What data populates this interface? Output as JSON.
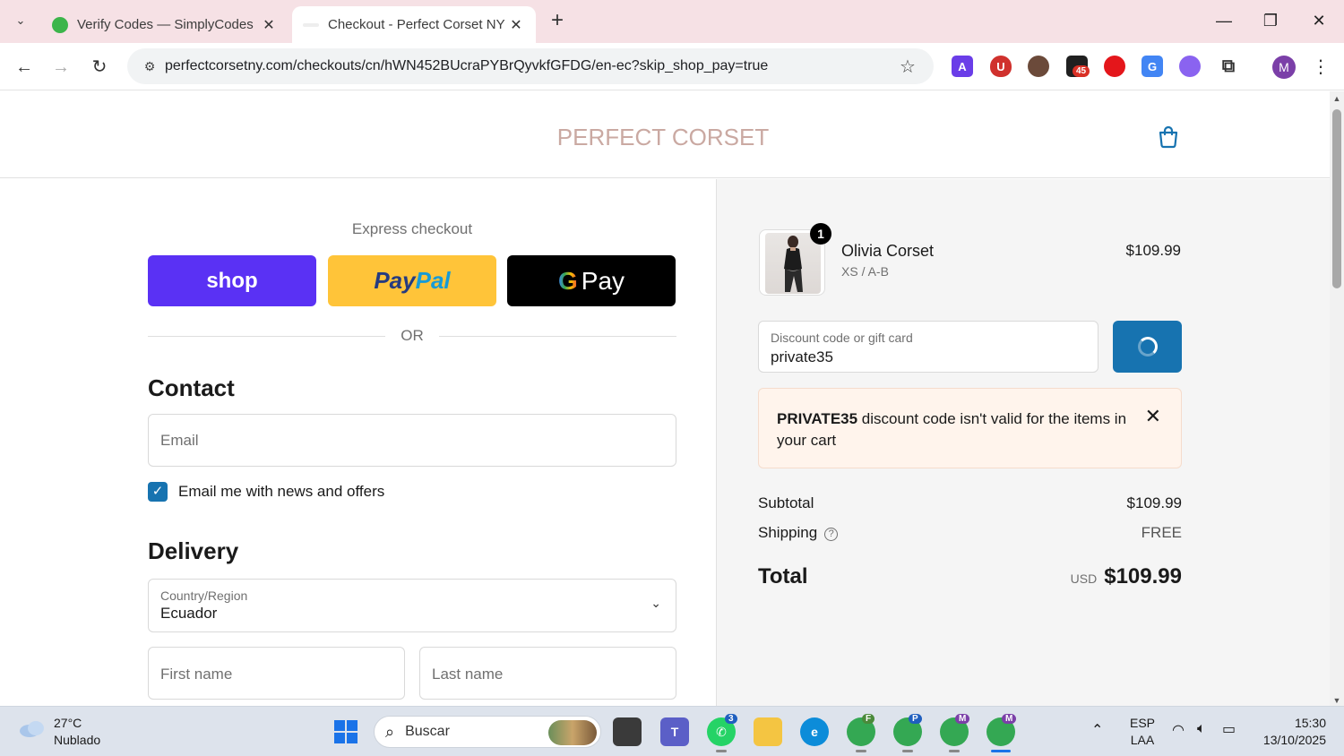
{
  "browser": {
    "tabs": [
      {
        "title": "Verify Codes — SimplyCodes",
        "active": false
      },
      {
        "title": "Checkout - Perfect Corset NY Co",
        "active": true
      }
    ],
    "url": "perfectcorsetny.com/checkouts/cn/hWN452BUcraPYBrQyvkfGFDG/en-ec?skip_shop_pay=true",
    "extension_badge": "45",
    "profile_initial": "M"
  },
  "store": {
    "logo": "PERFECT CORSET"
  },
  "checkout": {
    "express_title": "Express checkout",
    "shop_label": "shop",
    "paypal_label_a": "Pay",
    "paypal_label_b": "Pal",
    "gpay_g": "G",
    "gpay_label": "Pay",
    "or_text": "OR",
    "contact_title": "Contact",
    "email_placeholder": "Email",
    "news_checkbox_label": "Email me with news and offers",
    "delivery_title": "Delivery",
    "country_label": "Country/Region",
    "country_value": "Ecuador",
    "first_name_placeholder": "First name",
    "last_name_placeholder": "Last name"
  },
  "summary": {
    "item": {
      "quantity": "1",
      "name": "Olivia Corset",
      "variant": "XS / A-B",
      "price": "$109.99"
    },
    "discount_label": "Discount code or gift card",
    "discount_value": "private35",
    "error_code": "PRIVATE35",
    "error_message": " discount code isn't valid for the items in your cart",
    "subtotal_label": "Subtotal",
    "subtotal_value": "$109.99",
    "shipping_label": "Shipping",
    "shipping_value": "FREE",
    "total_label": "Total",
    "total_currency": "USD",
    "total_value": "$109.99"
  },
  "taskbar": {
    "weather_temp": "27°C",
    "weather_desc": "Nublado",
    "search_placeholder": "Buscar",
    "whatsapp_badge": "3",
    "chrome_profiles": [
      "F",
      "P",
      "M",
      "M"
    ],
    "lang": "ESP",
    "layout": "LAA",
    "time": "15:30",
    "date": "13/10/2025"
  },
  "colors": {
    "shop_purple": "#5a31f4",
    "paypal_yellow": "#ffc439",
    "accent_blue": "#1773b0",
    "error_bg": "#fff4ec",
    "logo_color": "#caa9a2"
  }
}
